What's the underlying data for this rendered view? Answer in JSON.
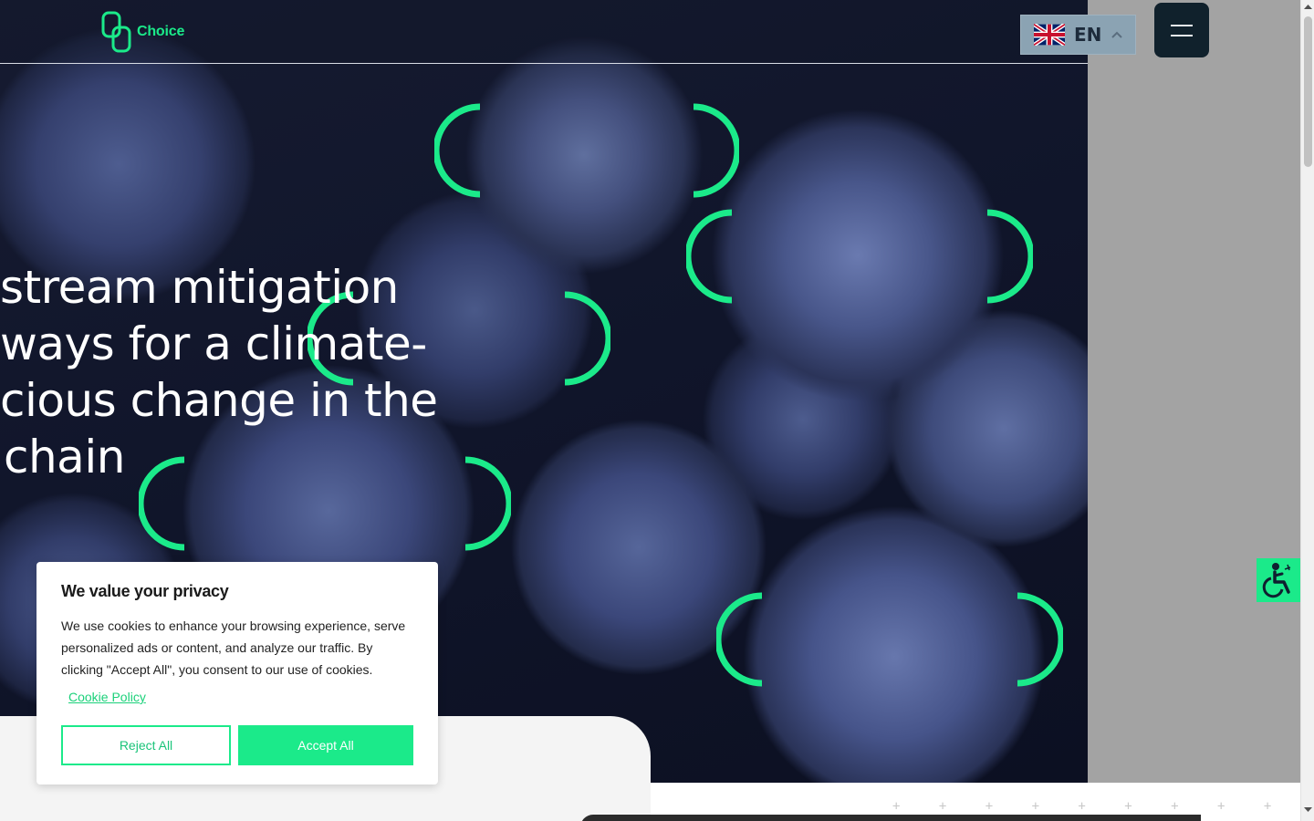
{
  "header": {
    "logo_text": "Choice",
    "language": {
      "code": "EN",
      "flag_icon": "uk-flag-icon",
      "chevron_icon": "chevron-up-icon"
    },
    "menu_icon": "hamburger-menu-icon"
  },
  "hero": {
    "headline_lines": [
      "stream mitigation",
      "ways for a climate-",
      "cious change in the",
      "chain"
    ]
  },
  "cookie_banner": {
    "title": "We value your privacy",
    "body": "We use cookies to enhance your browsing experience, serve personalized ads or content, and analyze our traffic. By clicking \"Accept All\", you consent to our use of cookies.",
    "policy_link": "Cookie Policy",
    "reject_label": "Reject All",
    "accept_label": "Accept All"
  },
  "accessibility": {
    "icon": "accessibility-icon"
  },
  "decor": {
    "plus_row": "+ + + + + + + + + + + + + + +"
  },
  "colors": {
    "accent_green": "#1bea8a",
    "menu_button_bg": "#10212c",
    "language_button_bg": "#8ba3b3",
    "side_panel_gray": "#a3a3a3"
  }
}
